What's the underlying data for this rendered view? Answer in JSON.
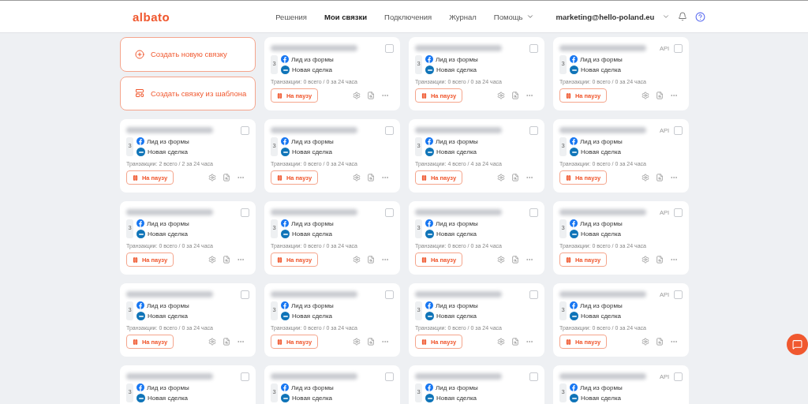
{
  "header": {
    "logo": "albato",
    "nav": [
      {
        "label": "Решения",
        "selected": false
      },
      {
        "label": "Мои связки",
        "selected": true
      },
      {
        "label": "Подключения",
        "selected": false
      },
      {
        "label": "Журнал",
        "selected": false
      },
      {
        "label": "Помощь",
        "selected": false,
        "dropdown": true
      }
    ],
    "account": "marketing@hello-poland.eu"
  },
  "actions": [
    {
      "label": "Создать новую связку",
      "kind": "new"
    },
    {
      "label": "Создать связку из шаблона",
      "kind": "template"
    }
  ],
  "cards": [
    {
      "count": "3",
      "trigger": "Лид из формы",
      "action": "Новая сделка",
      "transactions": "Транзакции: 0 всего / 0 за 24 часа",
      "button": "На паузу",
      "checked": false
    },
    {
      "count": "3",
      "trigger": "Лид из формы",
      "action": "Новая сделка",
      "transactions": "Транзакции: 0 всего / 0 за 24 часа",
      "button": "На паузу",
      "checked": false
    },
    {
      "api": "API",
      "count": "3",
      "trigger": "Лид из формы",
      "action": "Новая сделка",
      "transactions": "Транзакции: 0 всего / 0 за 24 часа",
      "button": "На паузу",
      "checked": false
    },
    {
      "count": "3",
      "trigger": "Лид из формы",
      "action": "Новая сделка",
      "transactions": "Транзакции: 2 всего / 2 за 24 часа",
      "button": "На паузу",
      "checked": false
    },
    {
      "count": "3",
      "trigger": "Лид из формы",
      "action": "Новая сделка",
      "transactions": "Транзакции: 0 всего / 0 за 24 часа",
      "button": "На паузу",
      "checked": false
    },
    {
      "count": "3",
      "trigger": "Лид из формы",
      "action": "Новая сделка",
      "transactions": "Транзакции: 4 всего / 4 за 24 часа",
      "button": "На паузу",
      "checked": false
    },
    {
      "api": "API",
      "count": "3",
      "trigger": "Лид из формы",
      "action": "Новая сделка",
      "transactions": "Транзакции: 0 всего / 0 за 24 часа",
      "button": "На паузу",
      "checked": false
    },
    {
      "count": "3",
      "trigger": "Лид из формы",
      "action": "Новая сделка",
      "transactions": "Транзакции: 0 всего / 0 за 24 часа",
      "button": "На паузу",
      "checked": false
    },
    {
      "count": "3",
      "trigger": "Лид из формы",
      "action": "Новая сделка",
      "transactions": "Транзакции: 0 всего / 0 за 24 часа",
      "button": "На паузу",
      "checked": false
    },
    {
      "count": "3",
      "trigger": "Лид из формы",
      "action": "Новая сделка",
      "transactions": "Транзакции: 0 всего / 0 за 24 часа",
      "button": "На паузу",
      "checked": false
    },
    {
      "api": "API",
      "count": "3",
      "trigger": "Лид из формы",
      "action": "Новая сделка",
      "transactions": "Транзакции: 0 всего / 0 за 24 часа",
      "button": "На паузу",
      "checked": false
    },
    {
      "count": "3",
      "trigger": "Лид из формы",
      "action": "Новая сделка",
      "transactions": "Транзакции: 0 всего / 0 за 24 часа",
      "button": "На паузу",
      "checked": false
    },
    {
      "count": "3",
      "trigger": "Лид из формы",
      "action": "Новая сделка",
      "transactions": "Транзакции: 0 всего / 0 за 24 часа",
      "button": "На паузу",
      "checked": false
    },
    {
      "count": "3",
      "trigger": "Лид из формы",
      "action": "Новая сделка",
      "transactions": "Транзакции: 0 всего / 0 за 24 часа",
      "button": "На паузу",
      "checked": false
    },
    {
      "api": "API",
      "count": "3",
      "trigger": "Лид из формы",
      "action": "Новая сделка",
      "transactions": "Транзакции: 0 всего / 0 за 24 часа",
      "button": "На паузу",
      "checked": false
    },
    {
      "count": "3",
      "trigger": "Лид из формы",
      "action": "Новая сделка",
      "checked": false
    },
    {
      "count": "3",
      "trigger": "Лид из формы",
      "action": "Новая сделка",
      "checked": false
    },
    {
      "count": "3",
      "trigger": "Лид из формы",
      "action": "Новая сделка",
      "checked": false
    },
    {
      "api": "API",
      "count": "3",
      "trigger": "Лид из формы",
      "action": "Новая сделка",
      "checked": false
    }
  ]
}
